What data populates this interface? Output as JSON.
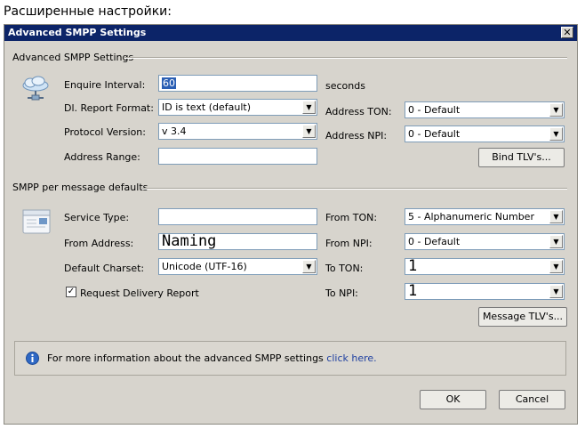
{
  "caption": "Расширенные настройки:",
  "window": {
    "title": "Advanced SMPP Settings",
    "close_glyph": "✕"
  },
  "advanced": {
    "group_label": "Advanced SMPP Settings",
    "enquire_label": "Enquire Interval:",
    "enquire_value": "60",
    "enquire_unit": "seconds",
    "dl_report_label": "Dl. Report Format:",
    "dl_report_value": "ID is text (default)",
    "protocol_label": "Protocol Version:",
    "protocol_value": "v 3.4",
    "address_range_label": "Address Range:",
    "address_range_value": "",
    "address_ton_label": "Address TON:",
    "address_ton_value": "0 - Default",
    "address_npi_label": "Address NPI:",
    "address_npi_value": "0 - Default",
    "bind_tlv_label": "Bind TLV's..."
  },
  "defaults": {
    "group_label": "SMPP per message defaults",
    "service_type_label": "Service Type:",
    "service_type_value": "",
    "from_address_label": "From Address:",
    "from_address_value": "Naming",
    "charset_label": "Default Charset:",
    "charset_value": "Unicode (UTF-16)",
    "delivery_report_label": "Request Delivery Report",
    "delivery_report_checked": true,
    "from_ton_label": "From TON:",
    "from_ton_value": "5 - Alphanumeric Number",
    "from_npi_label": "From NPI:",
    "from_npi_value": "0 - Default",
    "to_ton_label": "To TON:",
    "to_ton_value": "1",
    "to_npi_label": "To NPI:",
    "to_npi_value": "1",
    "message_tlv_label": "Message TLV's..."
  },
  "info": {
    "text": "For more information about the advanced SMPP settings",
    "link": "click here."
  },
  "buttons": {
    "ok": "OK",
    "cancel": "Cancel"
  },
  "colors": {
    "titlebar": "#0c2468",
    "dialog_bg": "#d7d4cd",
    "selection": "#2b5fb4",
    "link": "#1e3fa0"
  },
  "icons": [
    "cloud-network-icon",
    "message-card-icon",
    "info-icon",
    "dropdown-arrow-icon",
    "checkmark-icon",
    "close-icon"
  ]
}
